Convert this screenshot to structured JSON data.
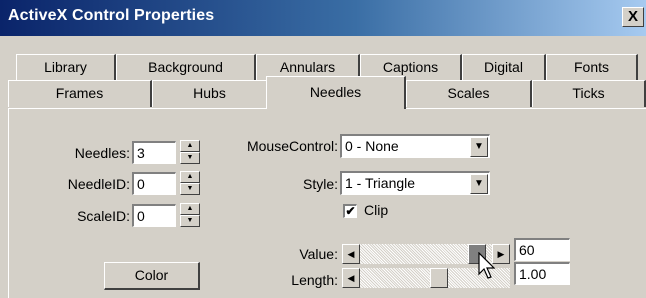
{
  "window": {
    "title": "ActiveX Control Properties",
    "close_label": "X"
  },
  "tabs_row1": [
    "Library",
    "Background",
    "Annulars",
    "Captions",
    "Digital",
    "Fonts"
  ],
  "tabs_row2": [
    "Frames",
    "Hubs",
    "Needles",
    "Scales",
    "Ticks"
  ],
  "active_tab": "Needles",
  "fields": {
    "needles": {
      "label": "Needles:",
      "value": "3"
    },
    "needle_id": {
      "label": "NeedleID:",
      "value": "0"
    },
    "scale_id": {
      "label": "ScaleID:",
      "value": "0"
    }
  },
  "mouse_control": {
    "label": "MouseControl:",
    "value": "0 - None"
  },
  "style": {
    "label": "Style:",
    "value": "1 - Triangle"
  },
  "clip": {
    "label": "Clip",
    "checked": true,
    "mark": "✔"
  },
  "color_button": {
    "label": "Color"
  },
  "value_slider": {
    "label": "Value:",
    "value": "60",
    "position_fraction": 0.6
  },
  "length_slider": {
    "label": "Length:",
    "value": "1.00"
  },
  "icons": {
    "spin_up": "▲",
    "spin_down": "▼",
    "dropdown": "▼",
    "arrow_left": "◀",
    "arrow_right": "▶"
  }
}
